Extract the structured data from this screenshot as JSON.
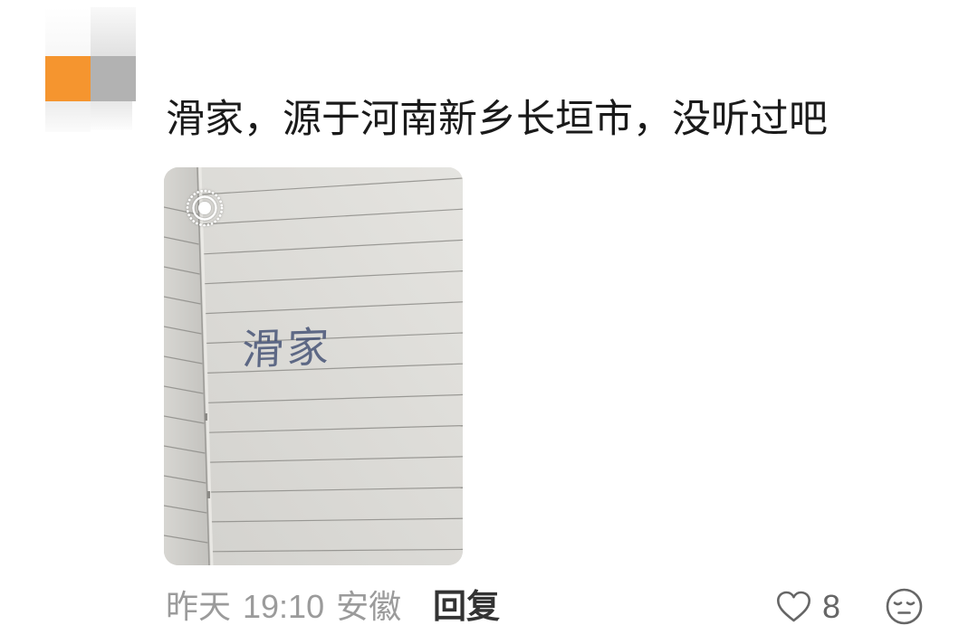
{
  "comment": {
    "text": "滑家，源于河南新乡长垣市，没听过吧"
  },
  "photo": {
    "handwriting": "滑家"
  },
  "meta": {
    "date": "昨天",
    "time": "19:10",
    "location": "安徽",
    "reply_label": "回复"
  },
  "actions": {
    "like_count": 8
  },
  "icons": {
    "live_photo": "live-photo-icon",
    "like": "heart-outline-icon",
    "reaction": "emoji-face-icon"
  },
  "colors": {
    "text_primary": "#1a1a1a",
    "text_secondary": "#9b9b9b",
    "reply": "#333333",
    "icon": "#666666",
    "avatar_accent": "#f5952f",
    "avatar_gray": "#b2b2b2"
  }
}
